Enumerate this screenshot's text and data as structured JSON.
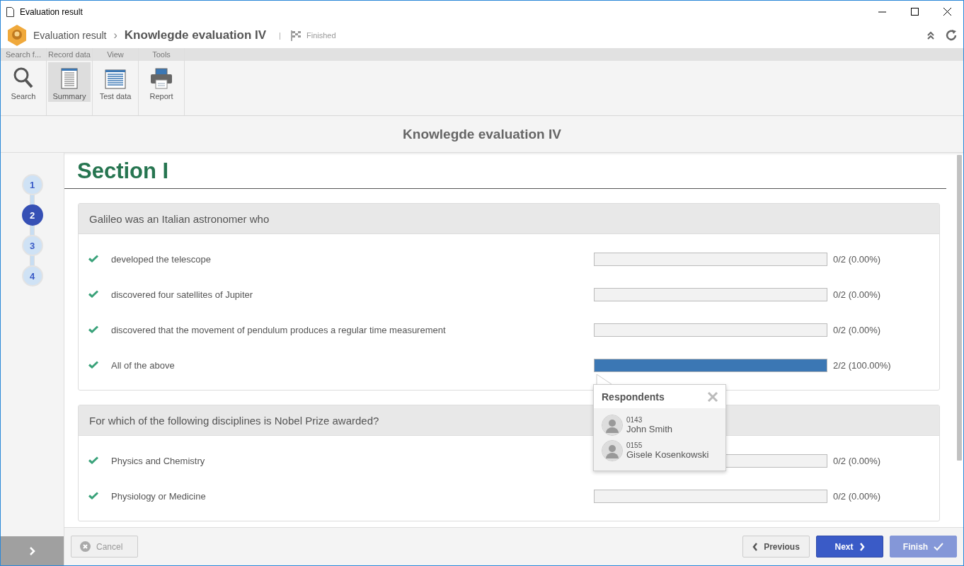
{
  "window": {
    "title": "Evaluation result"
  },
  "header": {
    "breadcrumb": "Evaluation result",
    "separator": "›",
    "title": "Knowlegde evaluation IV",
    "divider": "|",
    "status": "Finished"
  },
  "ribbon": [
    {
      "label": "Search f...",
      "buttons": [
        {
          "label": "Search",
          "selected": false
        }
      ]
    },
    {
      "label": "Record data",
      "buttons": [
        {
          "label": "Summary",
          "selected": true
        }
      ]
    },
    {
      "label": "View",
      "buttons": [
        {
          "label": "Test data",
          "selected": false
        }
      ]
    },
    {
      "label": "Tools",
      "buttons": [
        {
          "label": "Report",
          "selected": false
        }
      ]
    }
  ],
  "page_title": "Knowlegde evaluation IV",
  "steps": [
    {
      "label": "1",
      "selected": false
    },
    {
      "label": "2",
      "selected": true
    },
    {
      "label": "3",
      "selected": false
    },
    {
      "label": "4",
      "selected": false
    }
  ],
  "section": {
    "title": "Section I"
  },
  "questions": [
    {
      "text": "Galileo was an Italian astronomer who",
      "options": [
        {
          "text": "developed the telescope",
          "correct": true,
          "level": 0,
          "reading": "0/2 (0.00%)"
        },
        {
          "text": "discovered four satellites of Jupiter",
          "correct": true,
          "level": 0,
          "reading": "0/2 (0.00%)"
        },
        {
          "text": "discovered that the movement of pendulum produces a regular time measurement",
          "correct": true,
          "level": 0,
          "reading": "0/2 (0.00%)"
        },
        {
          "text": "All of the above",
          "correct": true,
          "level": 1,
          "reading": "2/2 (100.00%)"
        }
      ]
    },
    {
      "text": "For which of the following disciplines is Nobel Prize awarded?",
      "options": [
        {
          "text": "Physics and Chemistry",
          "correct": true,
          "level": 0,
          "reading": "0/2 (0.00%)"
        },
        {
          "text": "Physiology or Medicine",
          "correct": true,
          "level": 0,
          "reading": "0/2 (0.00%)"
        }
      ]
    }
  ],
  "respondents_popup": {
    "title": "Respondents",
    "people": [
      {
        "code": "0143",
        "name": "John Smith"
      },
      {
        "code": "0155",
        "name": "Gisele Kosenkowski"
      }
    ]
  },
  "footer": {
    "cancel": {
      "label": "Cancel",
      "disabled": true
    },
    "previous": {
      "label": "Previous",
      "disabled": false
    },
    "next": {
      "label": "Next",
      "disabled": false
    },
    "finish": {
      "label": "Finish",
      "disabled": true
    }
  }
}
